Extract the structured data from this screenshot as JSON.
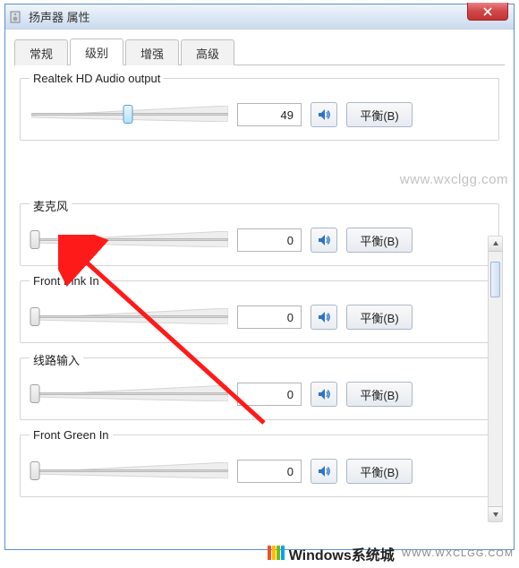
{
  "window": {
    "title": "扬声器 属性"
  },
  "tabs": [
    {
      "label": "常规"
    },
    {
      "label": "级别"
    },
    {
      "label": "增强"
    },
    {
      "label": "高级"
    }
  ],
  "active_tab_index": 1,
  "sliders": [
    {
      "legend": "Realtek HD Audio output",
      "value": "49",
      "percent": 49,
      "thumb_style": "blue",
      "balance_label": "平衡(B)"
    },
    {
      "legend": "麦克风",
      "value": "0",
      "percent": 0,
      "thumb_style": "gray",
      "balance_label": "平衡(B)"
    },
    {
      "legend": "Front Pink In",
      "value": "0",
      "percent": 0,
      "thumb_style": "gray",
      "balance_label": "平衡(B)"
    },
    {
      "legend": "线路输入",
      "value": "0",
      "percent": 0,
      "thumb_style": "gray",
      "balance_label": "平衡(B)"
    },
    {
      "legend": "Front Green In",
      "value": "0",
      "percent": 0,
      "thumb_style": "gray",
      "balance_label": "平衡(B)"
    }
  ],
  "watermarks": {
    "url": "www.wxclgg.com",
    "brand": "Windows系统城",
    "brand_sub": "WWW.WXCLGG.COM"
  }
}
